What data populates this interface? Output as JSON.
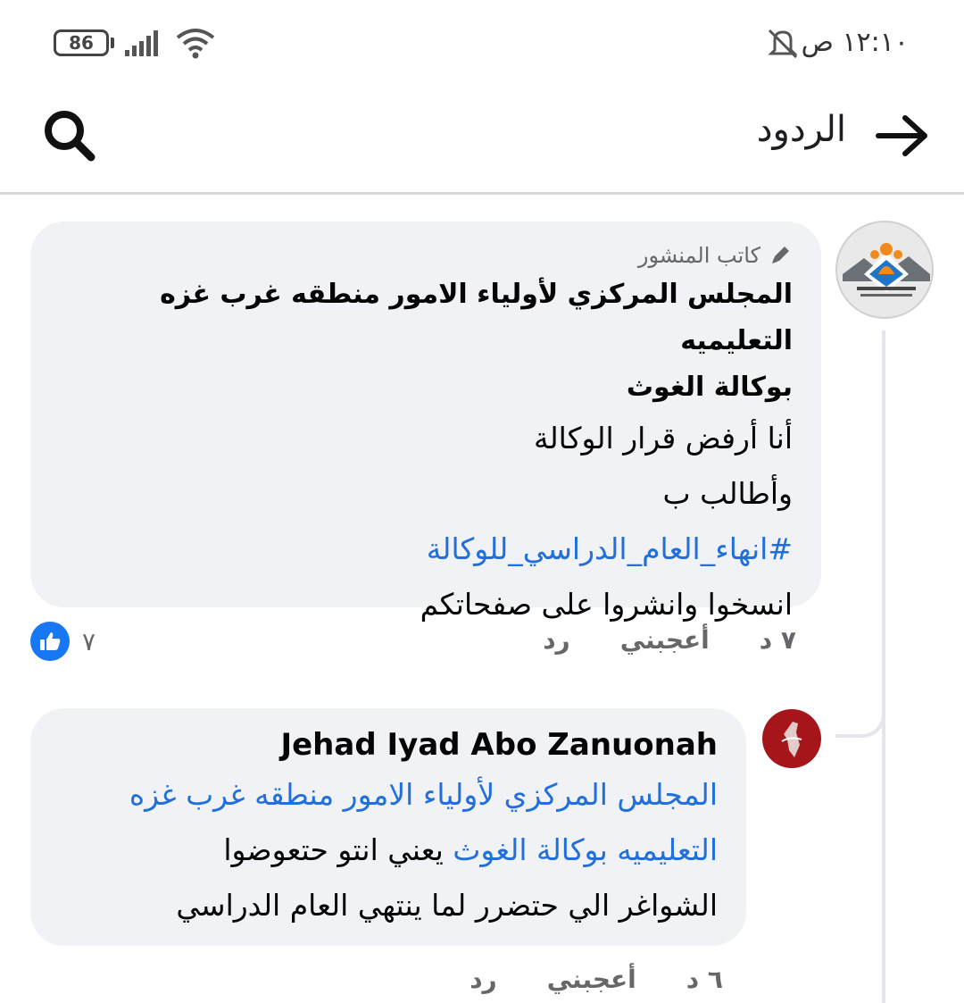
{
  "status_bar": {
    "battery": "86",
    "time": "١٢:١٠ ص",
    "icons": [
      "battery-icon",
      "signal-icon",
      "wifi-icon",
      "mute-icon"
    ]
  },
  "header": {
    "title": "الردود",
    "icons": [
      "arrow-right-icon",
      "search-icon"
    ]
  },
  "comment": {
    "author_badge": "كاتب المنشور",
    "author_name": "المجلس المركزي لأولياء الامور منطقه غرب غزه التعليميه بوكالة الغوث",
    "author_name_line1": "المجلس المركزي لأولياء الامور منطقه غرب غزه التعليميه",
    "author_name_line2": "بوكالة الغوث",
    "lines": [
      "أنا أرفض قرار الوكالة",
      "وأطالب ب",
      "#انهاء_العام_الدراسي_للوكالة",
      "انسخوا وانشروا على صفحاتكم"
    ],
    "time": "٧ د",
    "like_label": "أعجبني",
    "reply_label": "رد",
    "reaction_count": "٧"
  },
  "reply": {
    "author_name": "Jehad Iyad Abo Zanuonah",
    "mention_line1": "المجلس المركزي لأولياء الامور منطقه غرب غزه",
    "mention_line2": "التعليميه بوكالة الغوث",
    "text_after_mention": " يعني انتو حتعوضوا",
    "text_line3": "الشواغر الي حتضرر لما ينتهي العام الدراسي",
    "time": "٦ د",
    "like_label": "أعجبني",
    "reply_label": "رد"
  },
  "colors": {
    "link": "#216fdb",
    "bubble": "#f0f2f5",
    "like": "#1877f2",
    "secondary_text": "#65676b"
  }
}
